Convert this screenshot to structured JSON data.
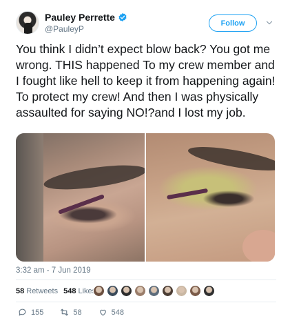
{
  "author": {
    "display_name": "Pauley Perrette",
    "handle": "@PauleyP"
  },
  "follow_label": "Follow",
  "tweet_text": "You think I didn’t expect blow back? You got me wrong. THIS happened To my crew member and I fought like hell to keep it from happening again! To protect my crew! And then I was physically assaulted for saying NO!?and I lost my job.",
  "timestamp": "3:32 am - 7 Jun 2019",
  "stats": {
    "retweets_count": "58",
    "retweets_label": "Retweets",
    "likes_count": "548",
    "likes_label": "Likes"
  },
  "actions": {
    "reply_count": "155",
    "retweet_count": "58",
    "like_count": "548"
  },
  "colors": {
    "accent": "#1da1f2",
    "text": "#14171a",
    "muted": "#657786",
    "divider": "#e6ecf0"
  },
  "liker_avatar_colors": [
    "#6b4f3f",
    "#3a4a5a",
    "#2d2d2d",
    "#9a7d6a",
    "#5b6b7b",
    "#4a3c33",
    "#c9b7a3",
    "#7a5a48",
    "#2f2f2f"
  ]
}
